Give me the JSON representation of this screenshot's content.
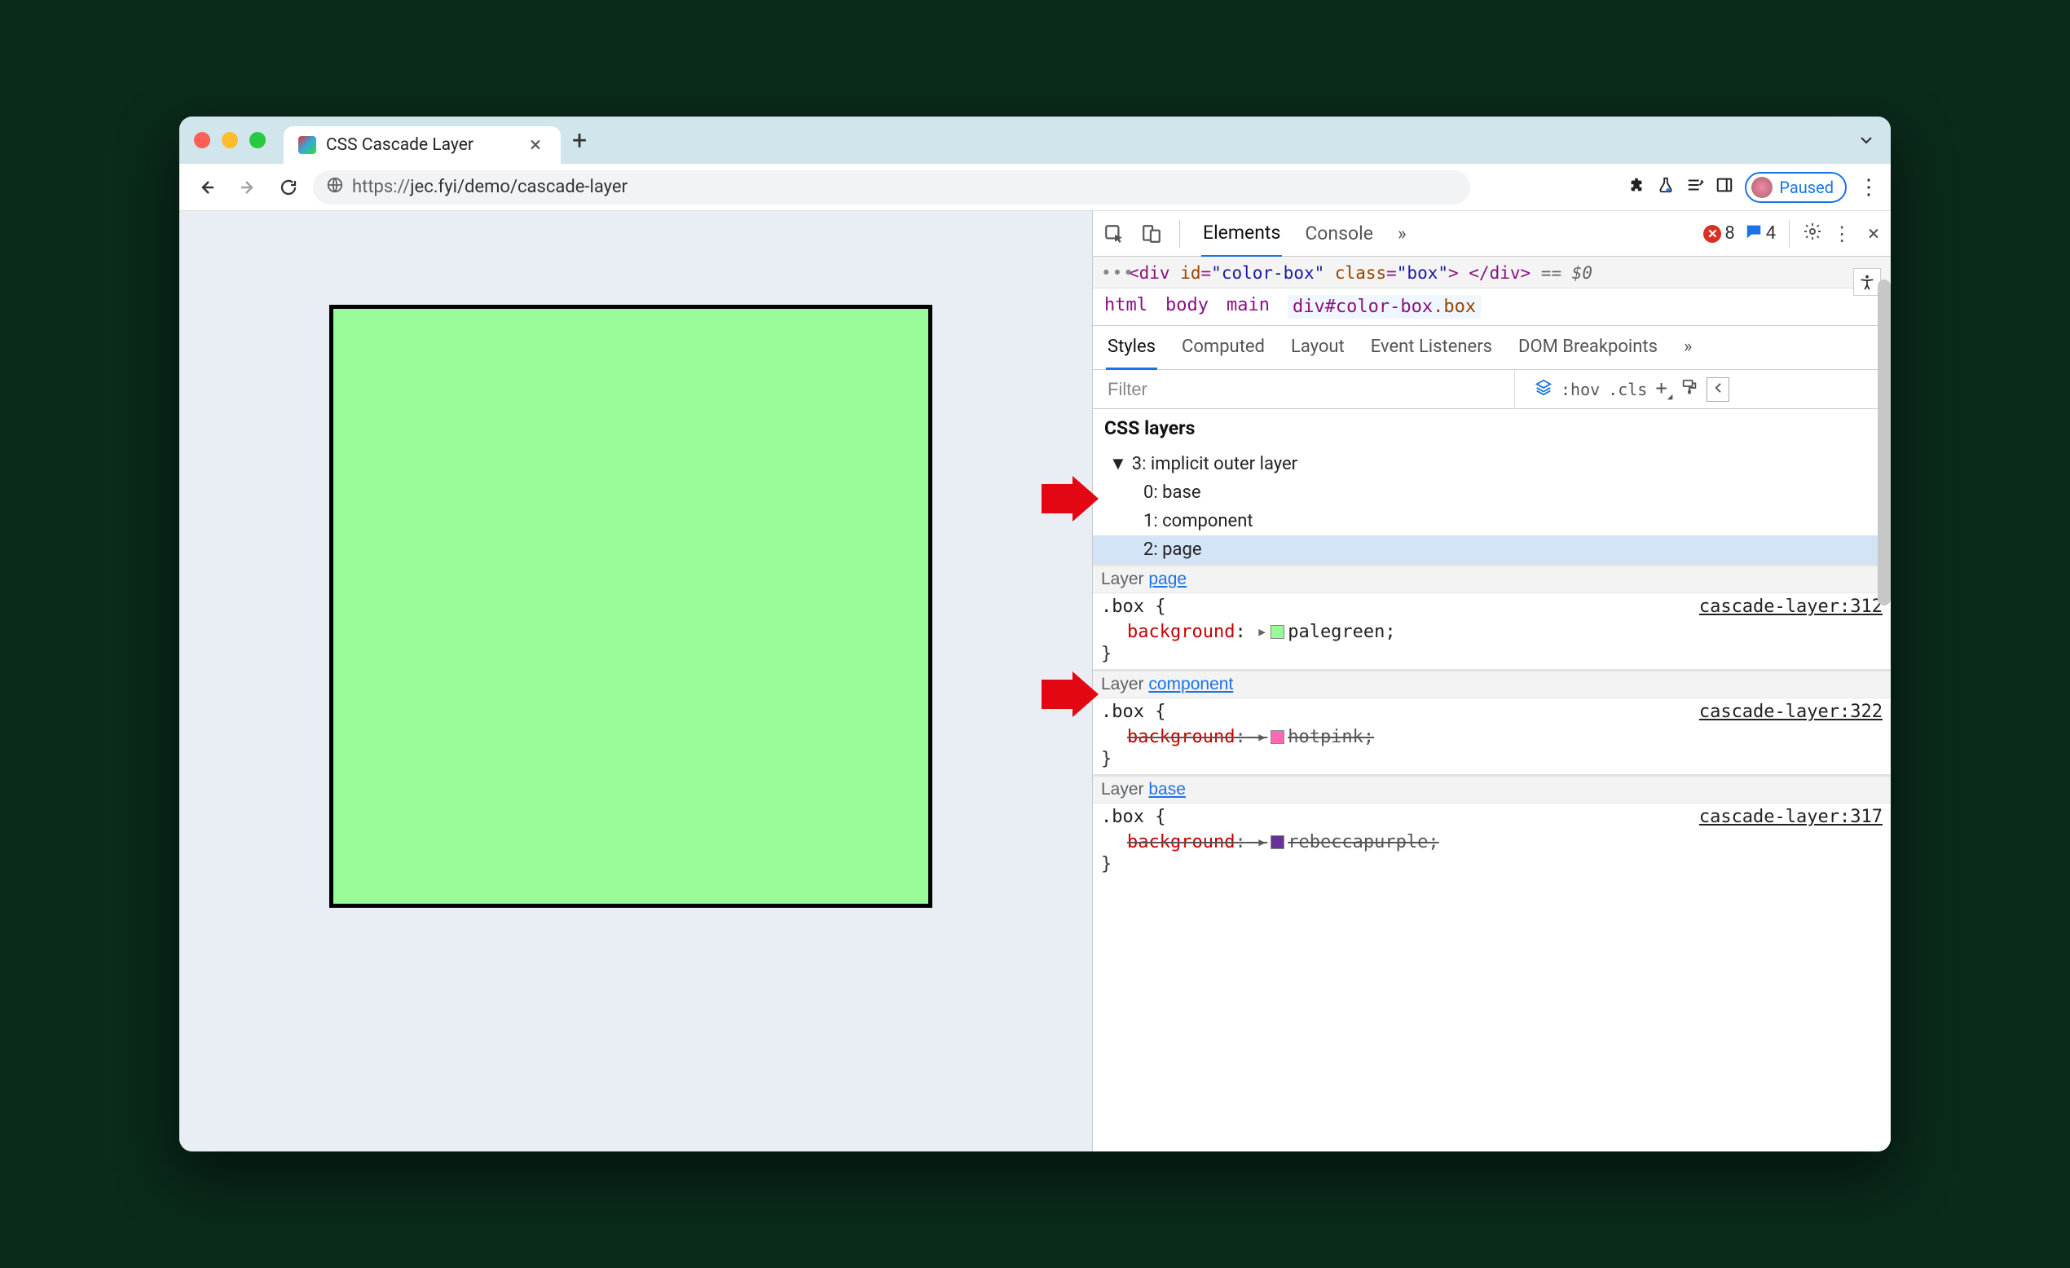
{
  "window": {
    "tab_title": "CSS Cascade Layer",
    "url_scheme": "https://",
    "url_rest": "jec.fyi/demo/cascade-layer",
    "paused_label": "Paused"
  },
  "devtools": {
    "tabs": {
      "elements": "Elements",
      "console": "Console"
    },
    "errors": "8",
    "msgs": "4",
    "dom_line_prefix": "<div ",
    "dom_line_id_attr": "id",
    "dom_line_id_val": "\"color-box\"",
    "dom_line_class_attr": "class",
    "dom_line_class_val": "\"box\"",
    "dom_line_close": "> </div>",
    "dom_sel": " == $0",
    "breadcrumb": {
      "html": "html",
      "body": "body",
      "main": "main",
      "sel": "div#color-box",
      "sel_dot": ".box"
    },
    "styles_tabs": {
      "styles": "Styles",
      "computed": "Computed",
      "layout": "Layout",
      "events": "Event Listeners",
      "dom": "DOM Breakpoints"
    },
    "filter_placeholder": "Filter",
    "filterbar": {
      "hov": ":hov",
      "cls": ".cls"
    },
    "css_layers_title": "CSS layers",
    "layers_tree": {
      "root": "3: implicit outer layer",
      "base": "0: base",
      "component": "1: component",
      "page": "2: page"
    },
    "rules": [
      {
        "layer_prefix": "Layer ",
        "layer_name": "page",
        "selector": ".box {",
        "source": "cascade-layer:312",
        "prop": "background",
        "swatch": "#98fb98",
        "value": "palegreen;",
        "overridden": false
      },
      {
        "layer_prefix": "Layer ",
        "layer_name": "component",
        "selector": ".box {",
        "source": "cascade-layer:322",
        "prop": "background",
        "swatch": "#ff69b4",
        "value": "hotpink;",
        "overridden": true
      },
      {
        "layer_prefix": "Layer ",
        "layer_name": "base",
        "selector": ".box {",
        "source": "cascade-layer:317",
        "prop": "background",
        "swatch": "#663399",
        "value": "rebeccapurple;",
        "overridden": true
      }
    ]
  }
}
